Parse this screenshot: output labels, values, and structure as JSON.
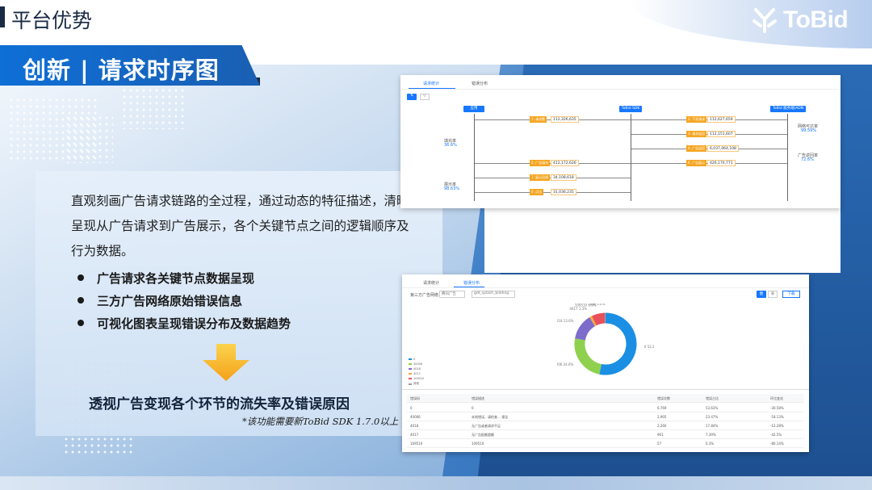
{
  "header": {
    "page_title": "平台优势",
    "logo_text": "ToBid"
  },
  "banner": {
    "text": "创新 | 请求时序图"
  },
  "left_card": {
    "description": "直观刻画广告请求链路的全过程，通过动态的特征描述，清晰呈现从广告请求到广告展示，各个关键节点之间的逻辑顺序及行为数据。",
    "bullets": [
      "广告请求各关键节点数据呈现",
      "三方广告网络原始错误信息",
      "可视化图表呈现错误分布及数据趋势"
    ],
    "conclusion": "透视广告变现各个环节的流失率及错误原因",
    "footnote": "*该功能需要新ToBid SDK 1.7.0以上"
  },
  "shot_sequence": {
    "tabs": [
      "请求统计",
      "错误分布"
    ],
    "active_tab": 0,
    "lanes": [
      "应用",
      "ToBid SDK",
      "ToBid 服务端/ADN"
    ],
    "steps": [
      {
        "label": "1. 请求数",
        "value": "112,326,635",
        "side": "left"
      },
      {
        "label": "2. 下发请求",
        "value": "112,627,659",
        "side": "right"
      },
      {
        "label": "3. 请求返回",
        "value": "112,151,607",
        "side": "right"
      },
      {
        "label": "4. 广告返回",
        "value": "6,037,064,108",
        "side": "right"
      },
      {
        "label": "5. 广告填充",
        "value": "412,172,626",
        "side": "left"
      },
      {
        "label": "6. 广告展示",
        "value": "426,170,771",
        "side": "right"
      },
      {
        "label": "7. 展示回调",
        "value": "34,108,618",
        "side": "left"
      },
      {
        "label": "8. 点击",
        "value": "31,036,235",
        "side": "left"
      }
    ],
    "side_metrics_left": [
      {
        "name": "填充率",
        "value": "36.6%"
      },
      {
        "name": "展示率",
        "value": "98.63%"
      }
    ],
    "side_metrics_right": [
      {
        "name": "网络可达率",
        "value": "99.59%"
      },
      {
        "name": "广告返回率",
        "value": "72.6%"
      }
    ]
  },
  "shot_errors": {
    "tabs": [
      "请求统计",
      "错误分布"
    ],
    "active_tab": 1,
    "filter_label": "第三方广告网络",
    "filter_value": "腾讯广告",
    "select_value": "gdt_splash_bidding",
    "buttons": [
      "图",
      "表",
      "下载"
    ],
    "legend": [
      {
        "name": "0",
        "color": "#1a8fe3"
      },
      {
        "name": "40006",
        "color": "#8fd14f"
      },
      {
        "name": "4018",
        "color": "#7e6ccb"
      },
      {
        "name": "4017",
        "color": "#f4a93c"
      },
      {
        "name": "109510",
        "color": "#e8505b"
      },
      {
        "name": "其他",
        "color": "#9e9e9e"
      }
    ],
    "chart_data": {
      "type": "pie",
      "labels": [
        "0",
        "40006",
        "4018",
        "4017",
        "109510",
        "其他"
      ],
      "values": [
        53.2,
        24.6,
        13.6,
        1.3,
        6.9,
        0.4
      ],
      "colors": [
        "#1a8fe3",
        "#8fd14f",
        "#7e6ccb",
        "#f4a93c",
        "#e8505b",
        "#9e9e9e"
      ]
    },
    "table": {
      "columns": [
        "错误码",
        "错误描述",
        "错误次数",
        "错误占比",
        "环比变化"
      ],
      "rows": [
        [
          "0",
          "0",
          "6,769",
          "53.63%",
          "-30.58%"
        ],
        [
          "40006",
          "未知错误，请检查… 报告",
          "2,905",
          "23.47%",
          "-18.13%"
        ],
        [
          "4018",
          "无广告或者请求不足",
          "2,260",
          "17.84%",
          "-12.28%"
        ],
        [
          "4017",
          "无广告配额超额",
          "961",
          "7.39%",
          "-42.5%"
        ],
        [
          "109510",
          "109510",
          "57",
          "0.3%",
          "-80.14%"
        ]
      ]
    }
  }
}
